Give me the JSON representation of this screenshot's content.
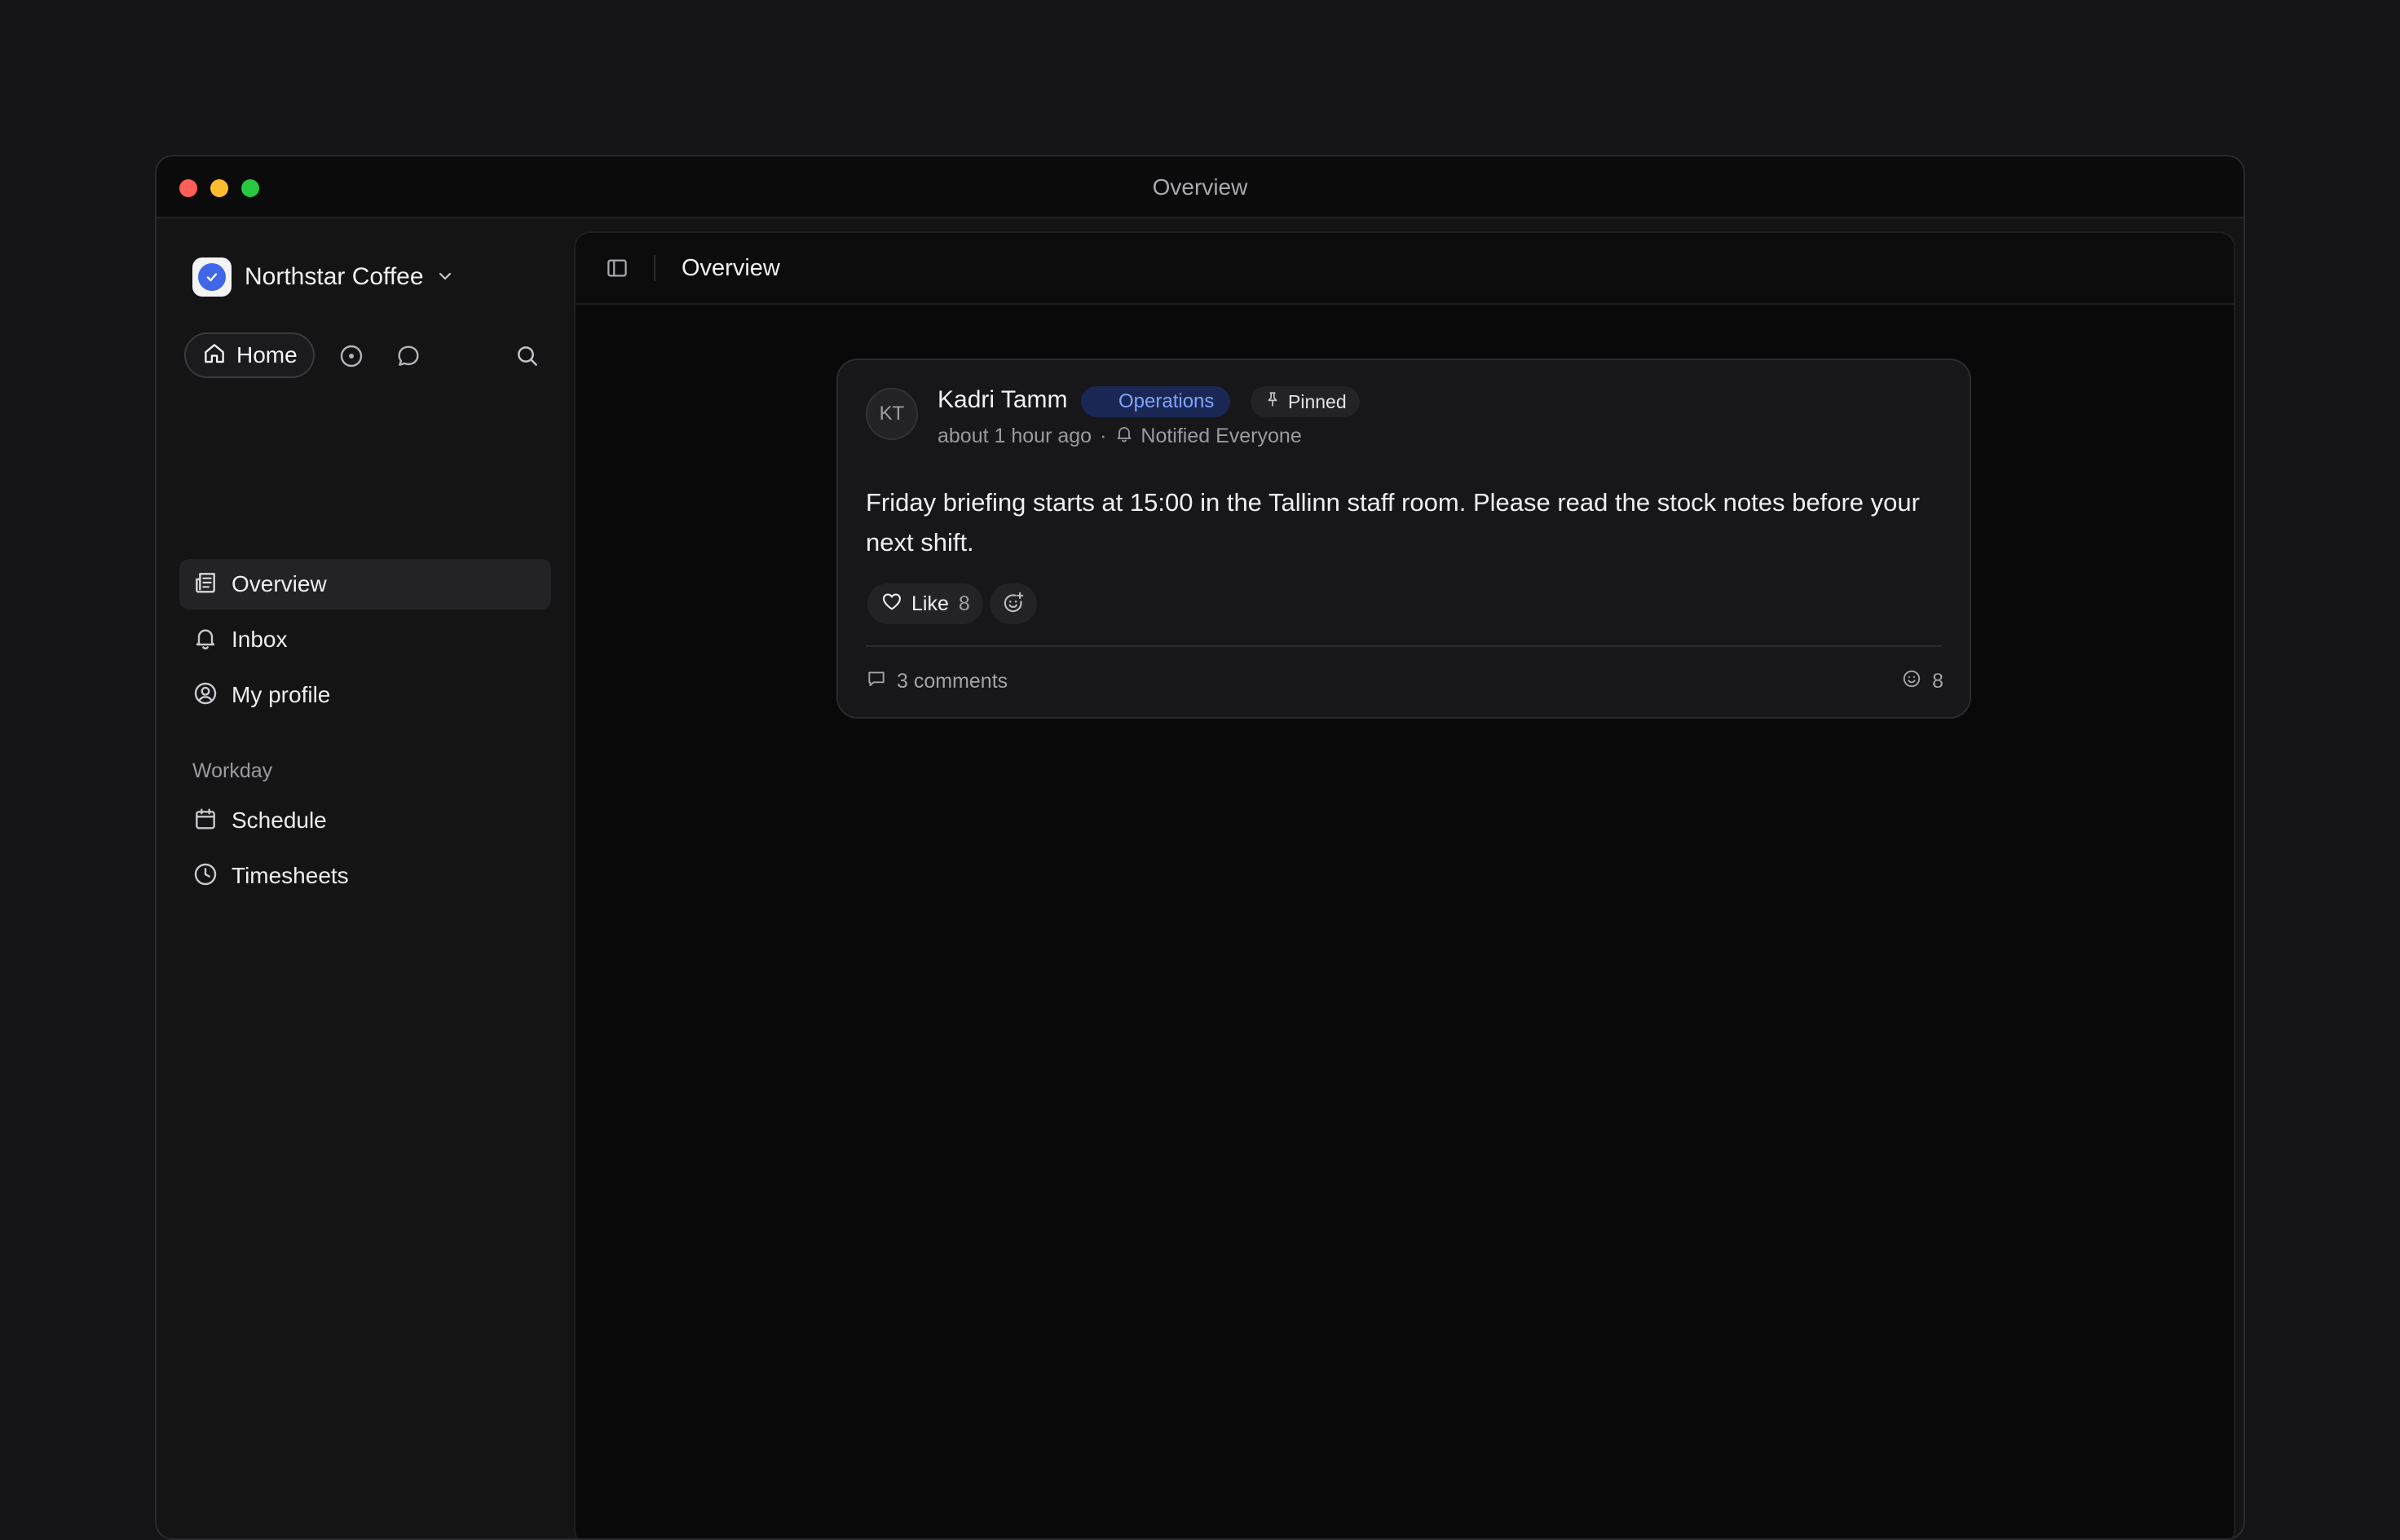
{
  "window": {
    "title": "Overview"
  },
  "sidebar": {
    "org_name": "Northstar Coffee",
    "home_label": "Home",
    "items": [
      {
        "label": "Overview",
        "icon": "newspaper-icon",
        "active": true
      },
      {
        "label": "Inbox",
        "icon": "bell-icon"
      },
      {
        "label": "My profile",
        "icon": "user-circle-icon"
      }
    ],
    "section_workday": "Workday",
    "workday_items": [
      {
        "label": "Schedule",
        "icon": "calendar-icon"
      },
      {
        "label": "Timesheets",
        "icon": "clock-icon"
      }
    ]
  },
  "main": {
    "title": "Overview",
    "post": {
      "avatar_initials": "KT",
      "author": "Kadri Tamm",
      "team_badge": "Operations",
      "pinned_label": "Pinned",
      "time": "about 1 hour ago",
      "separator": "·",
      "notified": "Notified Everyone",
      "body": "Friday briefing starts at 15:00 in the Tallinn staff room. Please read the stock notes before your next shift.",
      "like_label": "Like",
      "like_count": "8",
      "comments": "3 comments",
      "reaction_count": "8"
    }
  },
  "colors": {
    "accent": "#3f67e8",
    "badge_bg": "#1a2755",
    "badge_text": "#7fa5f7"
  }
}
